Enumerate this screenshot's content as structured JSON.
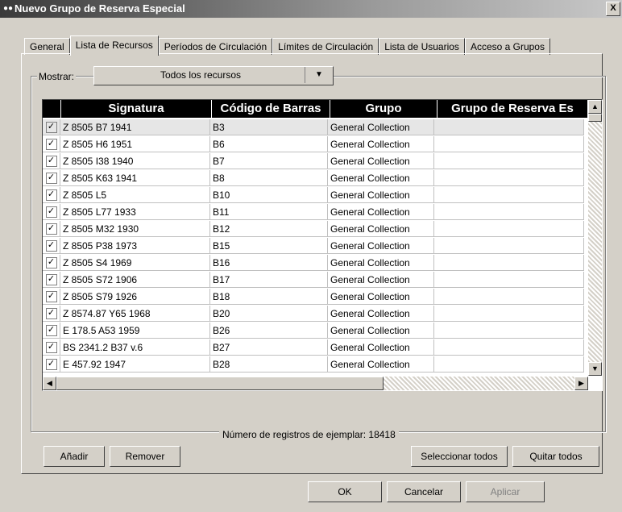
{
  "window": {
    "title": "Nuevo Grupo de Reserva Especial",
    "close_label": "X"
  },
  "tabs": [
    {
      "label": "General"
    },
    {
      "label": "Lista de Recursos"
    },
    {
      "label": "Períodos de Circulación"
    },
    {
      "label": "Límites de Circulación"
    },
    {
      "label": "Lista de Usuarios"
    },
    {
      "label": "Acceso a Grupos"
    }
  ],
  "filter": {
    "label": "Mostrar:",
    "selected": "Todos los recursos"
  },
  "table": {
    "columns": [
      "Signatura",
      "Código de Barras",
      "Grupo",
      "Grupo de Reserva Es"
    ],
    "rows": [
      {
        "sig": "Z 8505 B7 1941",
        "bar": "B3",
        "grp": "General Collection",
        "res": ""
      },
      {
        "sig": "Z 8505 H6 1951",
        "bar": "B6",
        "grp": "General Collection",
        "res": ""
      },
      {
        "sig": "Z 8505 I38 1940",
        "bar": "B7",
        "grp": "General Collection",
        "res": ""
      },
      {
        "sig": "Z 8505 K63 1941",
        "bar": "B8",
        "grp": "General Collection",
        "res": ""
      },
      {
        "sig": "Z 8505 L5",
        "bar": "B10",
        "grp": "General Collection",
        "res": ""
      },
      {
        "sig": "Z 8505 L77 1933",
        "bar": "B11",
        "grp": "General Collection",
        "res": ""
      },
      {
        "sig": "Z 8505 M32 1930",
        "bar": "B12",
        "grp": "General Collection",
        "res": ""
      },
      {
        "sig": "Z 8505 P38 1973",
        "bar": "B15",
        "grp": "General Collection",
        "res": ""
      },
      {
        "sig": "Z 8505 S4 1969",
        "bar": "B16",
        "grp": "General Collection",
        "res": ""
      },
      {
        "sig": "Z 8505 S72 1906",
        "bar": "B17",
        "grp": "General Collection",
        "res": ""
      },
      {
        "sig": "Z 8505 S79 1926",
        "bar": "B18",
        "grp": "General Collection",
        "res": ""
      },
      {
        "sig": "Z 8574.87 Y65 1968",
        "bar": "B20",
        "grp": "General Collection",
        "res": ""
      },
      {
        "sig": "E 178.5 A53 1959",
        "bar": "B26",
        "grp": "General Collection",
        "res": ""
      },
      {
        "sig": "BS 2341.2 B37 v.6",
        "bar": "B27",
        "grp": "General Collection",
        "res": ""
      },
      {
        "sig": "E 457.92 1947",
        "bar": "B28",
        "grp": "General Collection",
        "res": ""
      }
    ]
  },
  "record_count": "Número de registros de ejemplar: 18418",
  "buttons": {
    "add": "Añadir",
    "remove": "Remover",
    "select_all": "Seleccionar todos",
    "clear_all": "Quitar todos",
    "ok": "OK",
    "cancel": "Cancelar",
    "apply": "Aplicar"
  }
}
